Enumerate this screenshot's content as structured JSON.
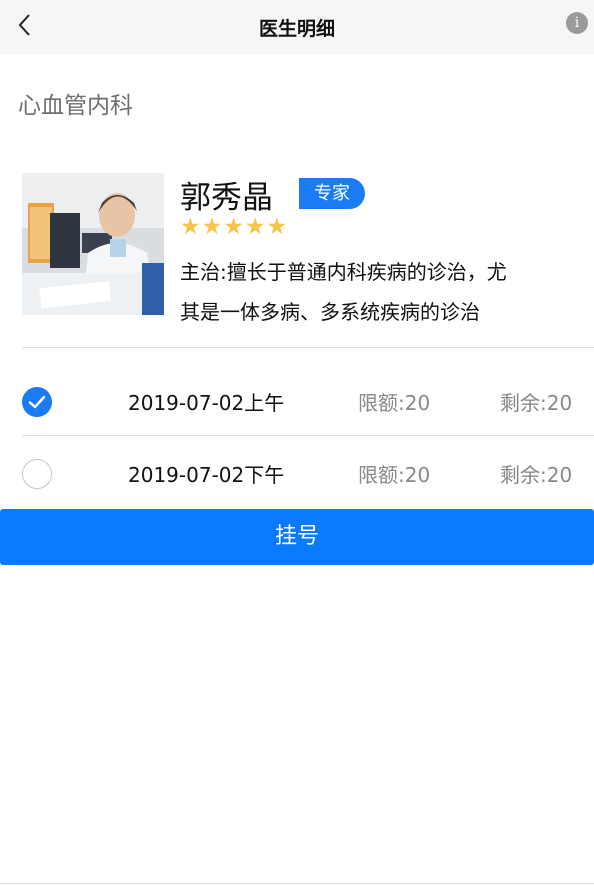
{
  "header": {
    "title": "医生明细",
    "back_icon": "chevron-left-icon",
    "info_icon": "info-icon",
    "info_glyph": "i"
  },
  "department": "心血管内科",
  "doctor": {
    "name": "郭秀晶",
    "badge": "专家",
    "rating": 5,
    "stars_text": "★★★★★",
    "specialty_line1": "主治:擅长于普通内科疾病的诊治，尤",
    "specialty_line2": "其是一体多病、多系统疾病的诊治"
  },
  "slots": [
    {
      "date": "2019-07-02上午",
      "limit": "限额:20",
      "remain": "剩余:20",
      "selected": true
    },
    {
      "date": "2019-07-02下午",
      "limit": "限额:20",
      "remain": "剩余:20",
      "selected": false
    }
  ],
  "register_button": "挂号",
  "colors": {
    "accent": "#0a7bff",
    "star": "#f7c548",
    "muted": "#888888"
  }
}
